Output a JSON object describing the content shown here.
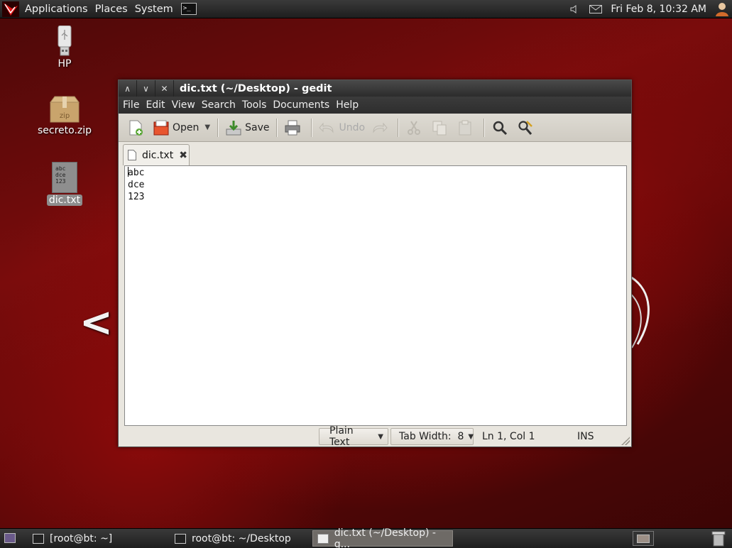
{
  "top_panel": {
    "menus": [
      "Applications",
      "Places",
      "System"
    ],
    "clock": "Fri Feb  8, 10:32 AM"
  },
  "desktop_icons": [
    {
      "label": "HP",
      "icon": "usb-drive-icon"
    },
    {
      "label": "secreto.zip",
      "icon": "zip-archive-icon"
    },
    {
      "label": "dic.txt",
      "icon": "text-file-icon",
      "preview": [
        "abc",
        "dce",
        "123"
      ]
    }
  ],
  "window": {
    "title": "dic.txt (~/Desktop) - gedit",
    "menus": [
      "File",
      "Edit",
      "View",
      "Search",
      "Tools",
      "Documents",
      "Help"
    ],
    "toolbar": {
      "open_label": "Open",
      "save_label": "Save",
      "undo_label": "Undo"
    },
    "tab": {
      "label": "dic.txt"
    },
    "editor_lines": [
      "abc",
      "dce",
      "123"
    ],
    "status": {
      "language": "Plain Text",
      "tab_width": "Tab Width:  8",
      "position": "Ln 1, Col 1",
      "mode": "INS"
    }
  },
  "taskbar": {
    "tasks": [
      {
        "label": "[root@bt: ~]",
        "active": false
      },
      {
        "label": "root@bt: ~/Desktop",
        "active": false
      },
      {
        "label": "dic.txt (~/Desktop) - g...",
        "active": true
      }
    ]
  }
}
